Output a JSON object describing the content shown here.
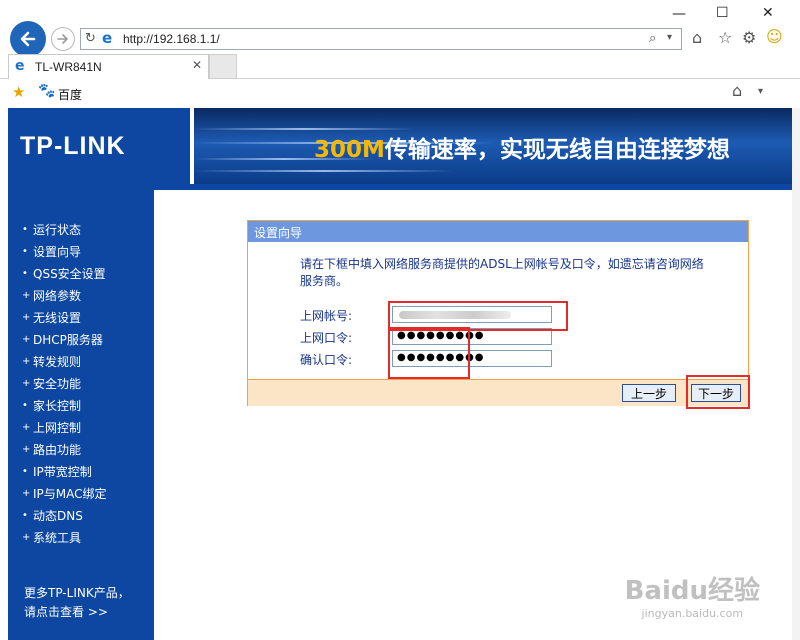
{
  "browser": {
    "url": "http://192.168.1.1/",
    "tab_title": "TL-WR841N",
    "favorites": [
      {
        "label": "百度"
      }
    ]
  },
  "banner": {
    "logo": "TP-LINK",
    "slogan_highlight": "300M",
    "slogan_rest": "传输速率，实现无线自由连接梦想"
  },
  "sidebar": {
    "items": [
      {
        "label": "运行状态",
        "bullet": "•"
      },
      {
        "label": "设置向导",
        "bullet": "•"
      },
      {
        "label": "QSS安全设置",
        "bullet": "•"
      },
      {
        "label": "网络参数",
        "bullet": "+"
      },
      {
        "label": "无线设置",
        "bullet": "+"
      },
      {
        "label": "DHCP服务器",
        "bullet": "+"
      },
      {
        "label": "转发规则",
        "bullet": "+"
      },
      {
        "label": "安全功能",
        "bullet": "+"
      },
      {
        "label": "家长控制",
        "bullet": "•"
      },
      {
        "label": "上网控制",
        "bullet": "+"
      },
      {
        "label": "路由功能",
        "bullet": "+"
      },
      {
        "label": "IP带宽控制",
        "bullet": "•"
      },
      {
        "label": "IP与MAC绑定",
        "bullet": "+"
      },
      {
        "label": "动态DNS",
        "bullet": "•"
      },
      {
        "label": "系统工具",
        "bullet": "+"
      }
    ],
    "more_line1": "更多TP-LINK产品，",
    "more_line2": "请点击查看 >>"
  },
  "wizard": {
    "title": "设置向导",
    "instructions": "请在下框中填入网络服务商提供的ADSL上网帐号及口令，如遗忘请咨询网络服务商。",
    "account_label": "上网帐号:",
    "password_label": "上网口令:",
    "confirm_label": "确认口令:",
    "password_value": "●●●●●●●●●",
    "confirm_value": "●●●●●●●●●",
    "prev_label": "上一步",
    "next_label": "下一步"
  },
  "watermark": {
    "text": "Baidu经验",
    "sub": "jingyan.baidu.com"
  },
  "colors": {
    "router_blue": "#0d47a1",
    "panel_header": "#6d98e0",
    "panel_border": "#f0a24a",
    "highlight_red": "#e32b2b"
  }
}
